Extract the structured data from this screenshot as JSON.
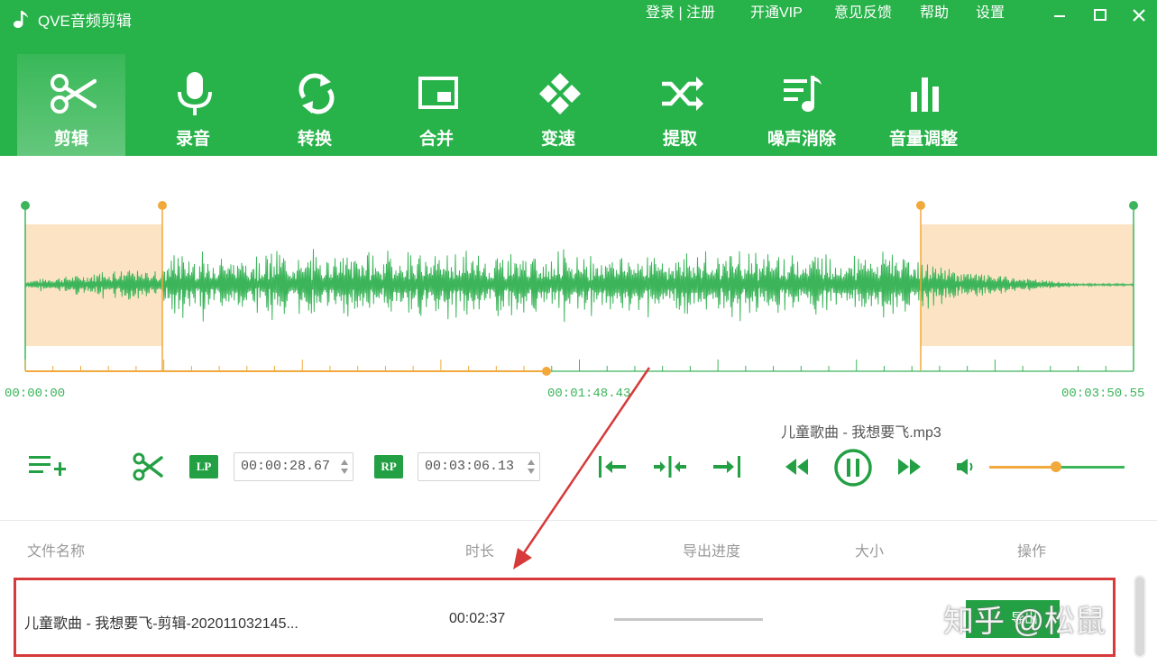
{
  "app": {
    "title": "QVE音频剪辑"
  },
  "top_links": {
    "login_register": "登录 | 注册",
    "vip": "开通VIP",
    "feedback": "意见反馈",
    "help": "帮助",
    "settings": "设置"
  },
  "nav": {
    "active": 0,
    "tabs": [
      {
        "label": "剪辑",
        "icon": "scissors-icon"
      },
      {
        "label": "录音",
        "icon": "microphone-icon"
      },
      {
        "label": "转换",
        "icon": "convert-icon"
      },
      {
        "label": "合并",
        "icon": "merge-icon"
      },
      {
        "label": "变速",
        "icon": "speed-icon"
      },
      {
        "label": "提取",
        "icon": "extract-icon"
      },
      {
        "label": "噪声消除",
        "icon": "noise-removal-icon"
      },
      {
        "label": "音量调整",
        "icon": "volume-adjust-icon"
      }
    ]
  },
  "timeline": {
    "start": "00:00:00",
    "middle": "00:01:48.43",
    "end": "00:03:50.55"
  },
  "player": {
    "current_file": "儿童歌曲 - 我想要飞.mp3",
    "lp_label": "LP",
    "lp_time": "00:00:28.67",
    "rp_label": "RP",
    "rp_time": "00:03:06.13",
    "volume_level": 0.49
  },
  "table": {
    "columns": [
      "文件名称",
      "时长",
      "导出进度",
      "大小",
      "操作"
    ],
    "rows": [
      {
        "name": "儿童歌曲 - 我想要飞-剪辑-202011032145...",
        "duration": "00:02:37",
        "export_label": "导出"
      }
    ]
  },
  "watermark": "知乎 @松鼠",
  "colors": {
    "brand_green": "#28b24a",
    "accent_orange": "#f2a93b",
    "wave_green": "#3cb55a",
    "highlight_red": "#d63a3a"
  }
}
